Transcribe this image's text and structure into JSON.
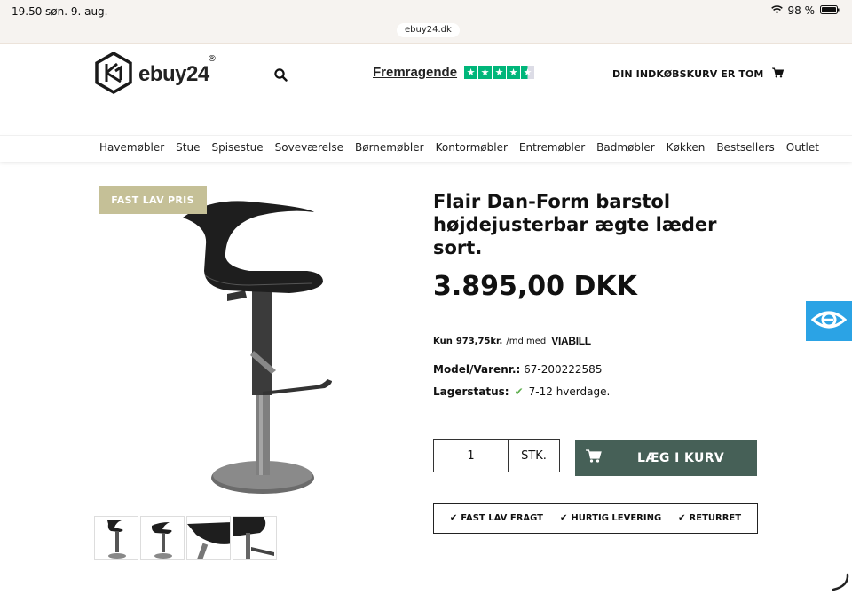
{
  "status_bar": {
    "time": "19.50",
    "date": "søn. 9. aug.",
    "battery": "98 %"
  },
  "browser": {
    "url": "ebuy24.dk"
  },
  "header": {
    "logo_text": "ebuy24",
    "logo_mark": "®",
    "rating_label": "Fremragende",
    "rating_stars": 4.5,
    "cart_text": "DIN INDKØBSKURV ER TOM"
  },
  "nav": {
    "items": [
      "Havemøbler",
      "Stue",
      "Spisestue",
      "Soveværelse",
      "Børnemøbler",
      "Kontormøbler",
      "Entremøbler",
      "Badmøbler",
      "Køkken",
      "Bestsellers",
      "Outlet"
    ]
  },
  "product": {
    "badge": "FAST LAV PRIS",
    "title": "Flair Dan-Form barstol højdejusterbar ægte læder sort.",
    "price": "3.895,00 DKK",
    "viabill_prefix": "Kun",
    "viabill_amount": "973,75kr.",
    "viabill_suffix": "/md med",
    "viabill_brand": "VIABILL",
    "model_label": "Model/Varenr.:",
    "model_value": "67-200222585",
    "stock_label": "Lagerstatus:",
    "stock_value": "7-12 hverdage.",
    "quantity": "1",
    "quantity_unit": "STK.",
    "add_to_cart": "LÆG I KURV",
    "perks": [
      "FAST LAV FRAGT",
      "HURTIG LEVERING",
      "RETURRET"
    ]
  },
  "colors": {
    "badge": "#c5c097",
    "add_to_cart": "#466057",
    "trustpilot": "#00b67a",
    "stock_check": "#5fae4e",
    "eye_widget": "#2ba3e5"
  }
}
